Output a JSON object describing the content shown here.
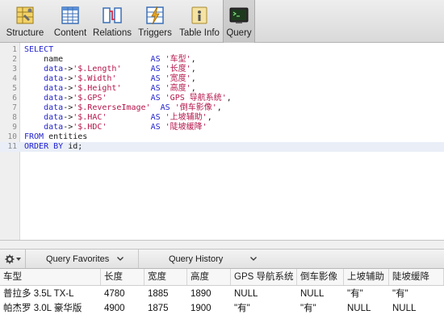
{
  "toolbar": {
    "tabs": [
      {
        "label": "Structure",
        "icon": "structure-icon"
      },
      {
        "label": "Content",
        "icon": "content-icon"
      },
      {
        "label": "Relations",
        "icon": "relations-icon"
      },
      {
        "label": "Triggers",
        "icon": "triggers-icon"
      },
      {
        "label": "Table Info",
        "icon": "table-info-icon"
      },
      {
        "label": "Query",
        "icon": "query-icon",
        "active": true
      }
    ]
  },
  "editor": {
    "lines": [
      {
        "n": "1",
        "parts": [
          [
            "kw",
            "SELECT"
          ]
        ]
      },
      {
        "n": "2",
        "parts": [
          [
            "plain",
            "    name                  "
          ],
          [
            "kw",
            "AS"
          ],
          [
            "plain",
            " "
          ],
          [
            "str",
            "'车型'"
          ],
          [
            "plain",
            ","
          ]
        ]
      },
      {
        "n": "3",
        "parts": [
          [
            "plain",
            "    "
          ],
          [
            "kw",
            "data"
          ],
          [
            "plain",
            "->"
          ],
          [
            "str",
            "'$.Length'"
          ],
          [
            "plain",
            "      "
          ],
          [
            "kw",
            "AS"
          ],
          [
            "plain",
            " "
          ],
          [
            "str",
            "'长度'"
          ],
          [
            "plain",
            ","
          ]
        ]
      },
      {
        "n": "4",
        "parts": [
          [
            "plain",
            "    "
          ],
          [
            "kw",
            "data"
          ],
          [
            "plain",
            "->"
          ],
          [
            "str",
            "'$.Width'"
          ],
          [
            "plain",
            "       "
          ],
          [
            "kw",
            "AS"
          ],
          [
            "plain",
            " "
          ],
          [
            "str",
            "'宽度'"
          ],
          [
            "plain",
            ","
          ]
        ]
      },
      {
        "n": "5",
        "parts": [
          [
            "plain",
            "    "
          ],
          [
            "kw",
            "data"
          ],
          [
            "plain",
            "->"
          ],
          [
            "str",
            "'$.Height'"
          ],
          [
            "plain",
            "      "
          ],
          [
            "kw",
            "AS"
          ],
          [
            "plain",
            " "
          ],
          [
            "str",
            "'高度'"
          ],
          [
            "plain",
            ","
          ]
        ]
      },
      {
        "n": "6",
        "parts": [
          [
            "plain",
            "    "
          ],
          [
            "kw",
            "data"
          ],
          [
            "plain",
            "->"
          ],
          [
            "str",
            "'$.GPS'"
          ],
          [
            "plain",
            "         "
          ],
          [
            "kw",
            "AS"
          ],
          [
            "plain",
            " "
          ],
          [
            "str",
            "'GPS 导航系统'"
          ],
          [
            "plain",
            ","
          ]
        ]
      },
      {
        "n": "7",
        "parts": [
          [
            "plain",
            "    "
          ],
          [
            "kw",
            "data"
          ],
          [
            "plain",
            "->"
          ],
          [
            "str",
            "'$.ReverseImage'"
          ],
          [
            "plain",
            "  "
          ],
          [
            "kw",
            "AS"
          ],
          [
            "plain",
            " "
          ],
          [
            "str",
            "'倒车影像'"
          ],
          [
            "plain",
            ","
          ]
        ]
      },
      {
        "n": "8",
        "parts": [
          [
            "plain",
            "    "
          ],
          [
            "kw",
            "data"
          ],
          [
            "plain",
            "->"
          ],
          [
            "str",
            "'$.HAC'"
          ],
          [
            "plain",
            "         "
          ],
          [
            "kw",
            "AS"
          ],
          [
            "plain",
            " "
          ],
          [
            "str",
            "'上坡辅助'"
          ],
          [
            "plain",
            ","
          ]
        ]
      },
      {
        "n": "9",
        "parts": [
          [
            "plain",
            "    "
          ],
          [
            "kw",
            "data"
          ],
          [
            "plain",
            "->"
          ],
          [
            "str",
            "'$.HDC'"
          ],
          [
            "plain",
            "         "
          ],
          [
            "kw",
            "AS"
          ],
          [
            "plain",
            " "
          ],
          [
            "str",
            "'陡坡缓降'"
          ]
        ]
      },
      {
        "n": "10",
        "parts": [
          [
            "kw",
            "FROM"
          ],
          [
            "plain",
            " entities"
          ]
        ]
      },
      {
        "n": "11",
        "parts": [
          [
            "kw",
            "ORDER BY"
          ],
          [
            "plain",
            " id;"
          ]
        ]
      }
    ]
  },
  "favbar": {
    "gear_icon": "gear-icon",
    "favorites_label": "Query Favorites",
    "history_label": "Query History"
  },
  "results": {
    "columns": [
      "车型",
      "长度",
      "宽度",
      "高度",
      "GPS 导航系统",
      "倒车影像",
      "上坡辅助",
      "陡坡缓降"
    ],
    "rows": [
      [
        "普拉多 3.5L TX-L",
        "4780",
        "1885",
        "1890",
        "NULL",
        "NULL",
        "\"有\"",
        "\"有\""
      ],
      [
        "帕杰罗 3.0L 豪华版",
        "4900",
        "1875",
        "1900",
        "\"有\"",
        "\"有\"",
        "NULL",
        "NULL"
      ]
    ]
  },
  "colors": {
    "keyword": "#2323cf",
    "string": "#b5154a",
    "null_text": "#9a9a9a",
    "selected_line": "#e9eef7"
  }
}
